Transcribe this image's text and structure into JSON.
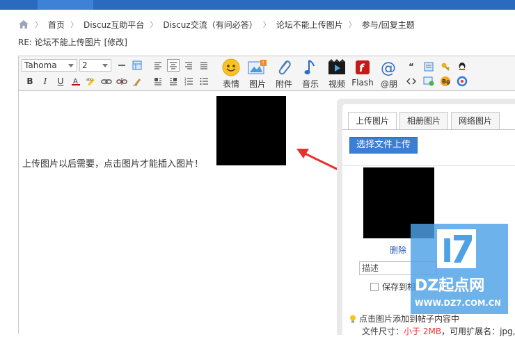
{
  "breadcrumb": {
    "items": [
      "首页",
      "Discuz互助平台",
      "Discuz交流（有问必答）",
      "论坛不能上传图片",
      "参与/回复主题"
    ]
  },
  "post": {
    "subject": "RE: 论坛不能上传图片",
    "edit_link": "[修改]"
  },
  "toolbar": {
    "font_family": "Tahoma",
    "font_size": "2",
    "buttons": [
      {
        "label": "表情",
        "icon": "emoticon-icon"
      },
      {
        "label": "图片",
        "icon": "image-icon"
      },
      {
        "label": "附件",
        "icon": "attachment-icon"
      },
      {
        "label": "音乐",
        "icon": "music-icon"
      },
      {
        "label": "视频",
        "icon": "video-icon"
      },
      {
        "label": "Flash",
        "icon": "flash-icon"
      },
      {
        "label": "@朋",
        "icon": "at-icon"
      }
    ]
  },
  "content": {
    "text": "上传图片以后需要，点击图片才能插入图片！"
  },
  "image_panel": {
    "tabs": [
      "上传图片",
      "相册图片",
      "网络图片"
    ],
    "active_tab": "上传图片",
    "upload_button": "选择文件上传",
    "delete_label": "删除",
    "description_value": "描述",
    "save_to_album": "保存到相",
    "hint": "点击图片添加到帖子内容中",
    "size_hint_prefix": "文件尺寸：",
    "size_hint_value": "小于 2MB",
    "size_hint_suffix": "，可用扩展名：jpg, j"
  },
  "watermark": {
    "logo": "DZ起点网",
    "url": "WWW.DZ7.COM.CN"
  },
  "colors": {
    "accent_blue": "#3a7fd5",
    "arrow_red": "#e8312f",
    "watermark_blue": "#4ea1e6"
  }
}
